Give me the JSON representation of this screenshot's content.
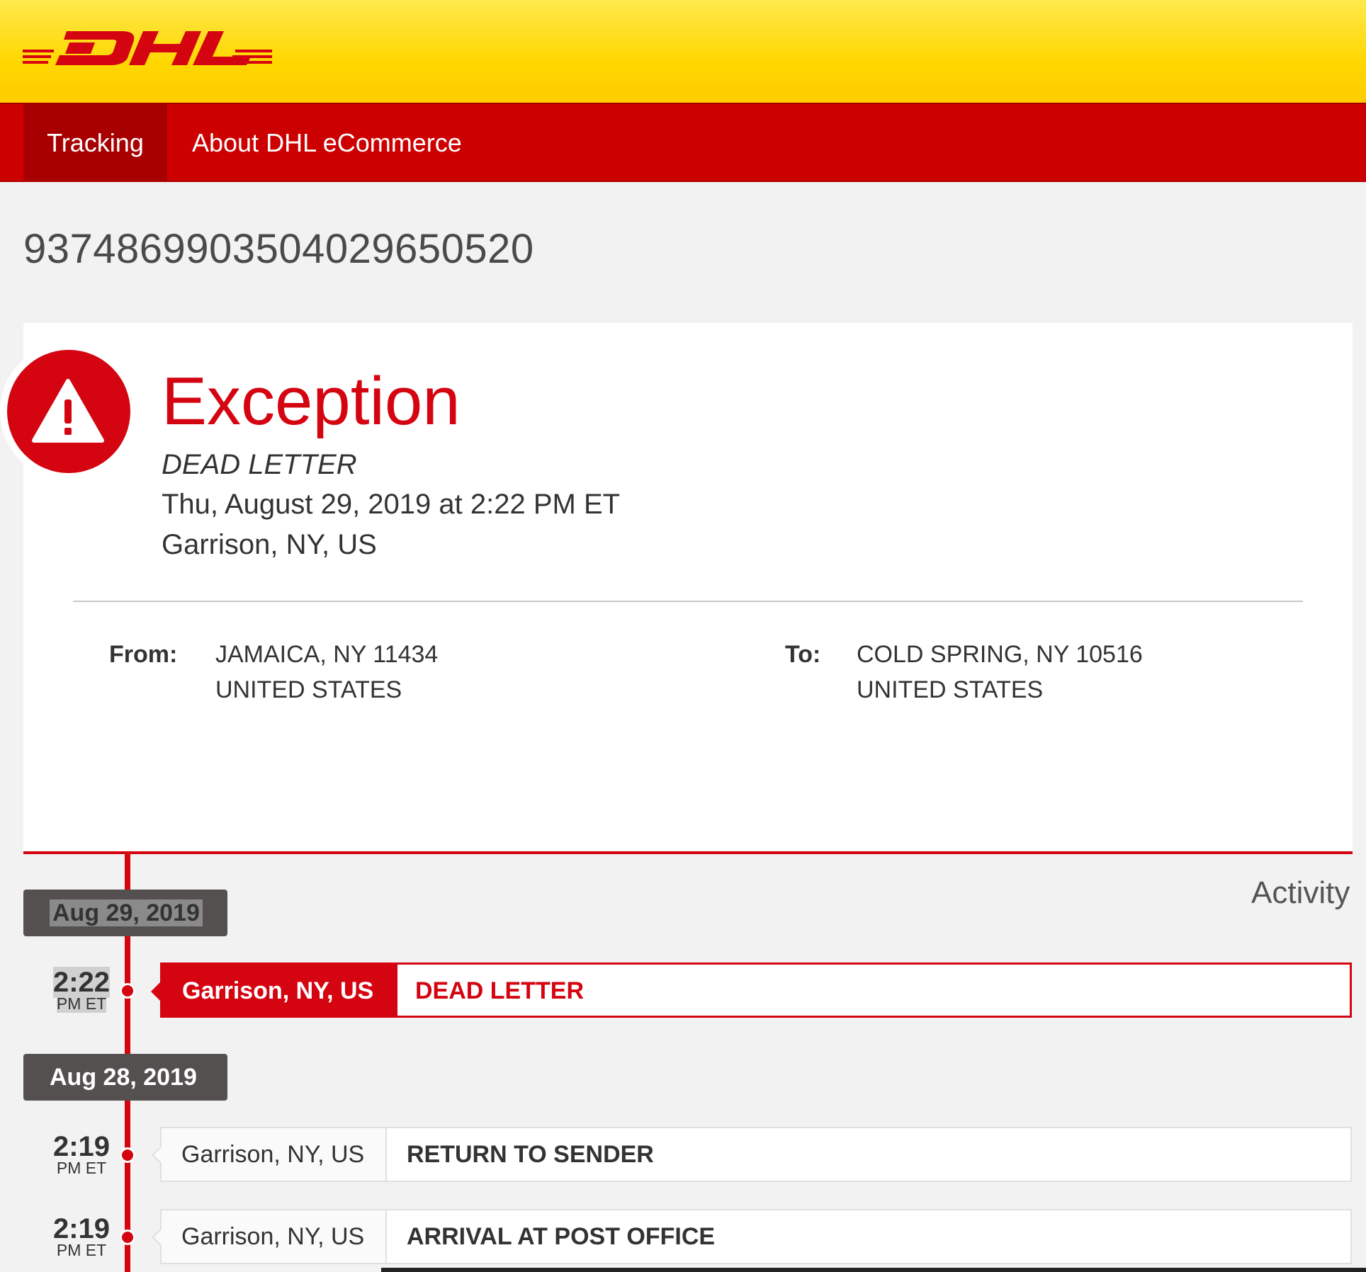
{
  "brand": {
    "logo_text": "DHL",
    "primary_color": "#ffcc00",
    "accent_color": "#d40511"
  },
  "nav": {
    "items": [
      {
        "label": "Tracking",
        "active": true
      },
      {
        "label": "About DHL eCommerce",
        "active": false
      }
    ]
  },
  "tracking_number": "9374869903504029650520",
  "status": {
    "icon": "warning-icon",
    "title": "Exception",
    "detail": "DEAD LETTER",
    "datetime": "Thu, August 29, 2019 at 2:22 PM ET",
    "location": "Garrison, NY, US"
  },
  "shipment": {
    "from_label": "From:",
    "from_line1": "JAMAICA, NY 11434",
    "from_line2": "UNITED STATES",
    "to_label": "To:",
    "to_line1": "COLD SPRING, NY 10516",
    "to_line2": "UNITED STATES"
  },
  "activity": {
    "label": "Activity",
    "groups": [
      {
        "date": "Aug 29, 2019",
        "events": [
          {
            "time": "2:22",
            "period": "PM ET",
            "location": "Garrison, NY, US",
            "description": "DEAD LETTER"
          }
        ]
      },
      {
        "date": "Aug 28, 2019",
        "events": [
          {
            "time": "2:19",
            "period": "PM ET",
            "location": "Garrison, NY, US",
            "description": "RETURN TO SENDER"
          },
          {
            "time": "2:19",
            "period": "PM ET",
            "location": "Garrison, NY, US",
            "description": "ARRIVAL AT POST OFFICE"
          }
        ]
      }
    ]
  }
}
